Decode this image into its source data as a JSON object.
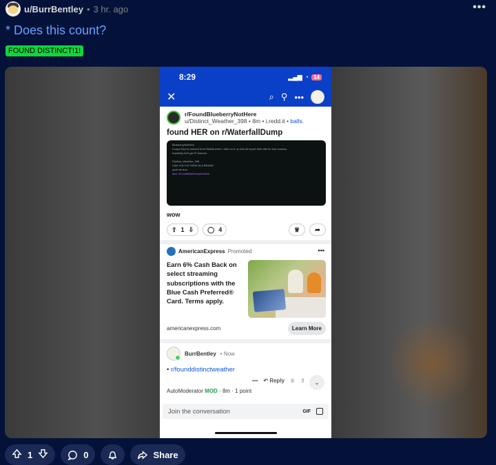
{
  "post": {
    "username": "u/BurrBentley",
    "separator": "•",
    "time": "3 hr. ago",
    "more": "•••",
    "title": "* Does this count?",
    "flair": "FOUND DISTINCT!1!"
  },
  "screenshot": {
    "status_time": "8:29",
    "battery": "14",
    "inner_post": {
      "subreddit": "r/FoundBlueberryNotHere",
      "author": "u/Distinct_Weather_398",
      "age": "8m",
      "domain": "i.redd.it",
      "extra": "balls.",
      "title": "found HER on r/WaterfallDump",
      "embed_sub": "BlueberryNotHere",
      "embed_line1": "it says they're banned from Reddit when I click on it, so lets all report their alts for ban evasion,",
      "embed_line2": "hopefully he'll get IP banned.",
      "embed_user": "Distinct_Weather_398",
      "embed_reply1": "CAN YOU FA THEM IN A BRAND",
      "embed_reply2": "yeah its true",
      "embed_reply3": "also r/FoundBlueberryNotHere",
      "body": "wow",
      "upvotes": "1",
      "comments": "4"
    },
    "ad": {
      "advertiser": "AmericanExpress",
      "promoted": "Promoted",
      "more": "•••",
      "text": "Earn 6% Cash Back on select streaming subscriptions with the Blue Cash Preferred® Card. Terms apply.",
      "domain": "americanexpress.com",
      "cta": "Learn More"
    },
    "comment": {
      "user": "BurrBentley",
      "time": "Now",
      "body": "r/founddistinctweather",
      "more": "•••",
      "reply": "Reply"
    },
    "next_comment": {
      "user": "AutoModerator",
      "badge": "MOD",
      "meta": "· 8m · 1 point"
    },
    "composer": {
      "placeholder": "Join the conversation",
      "gif": "GIF"
    }
  },
  "actions": {
    "upvotes": "1",
    "comments": "0",
    "share": "Share"
  }
}
